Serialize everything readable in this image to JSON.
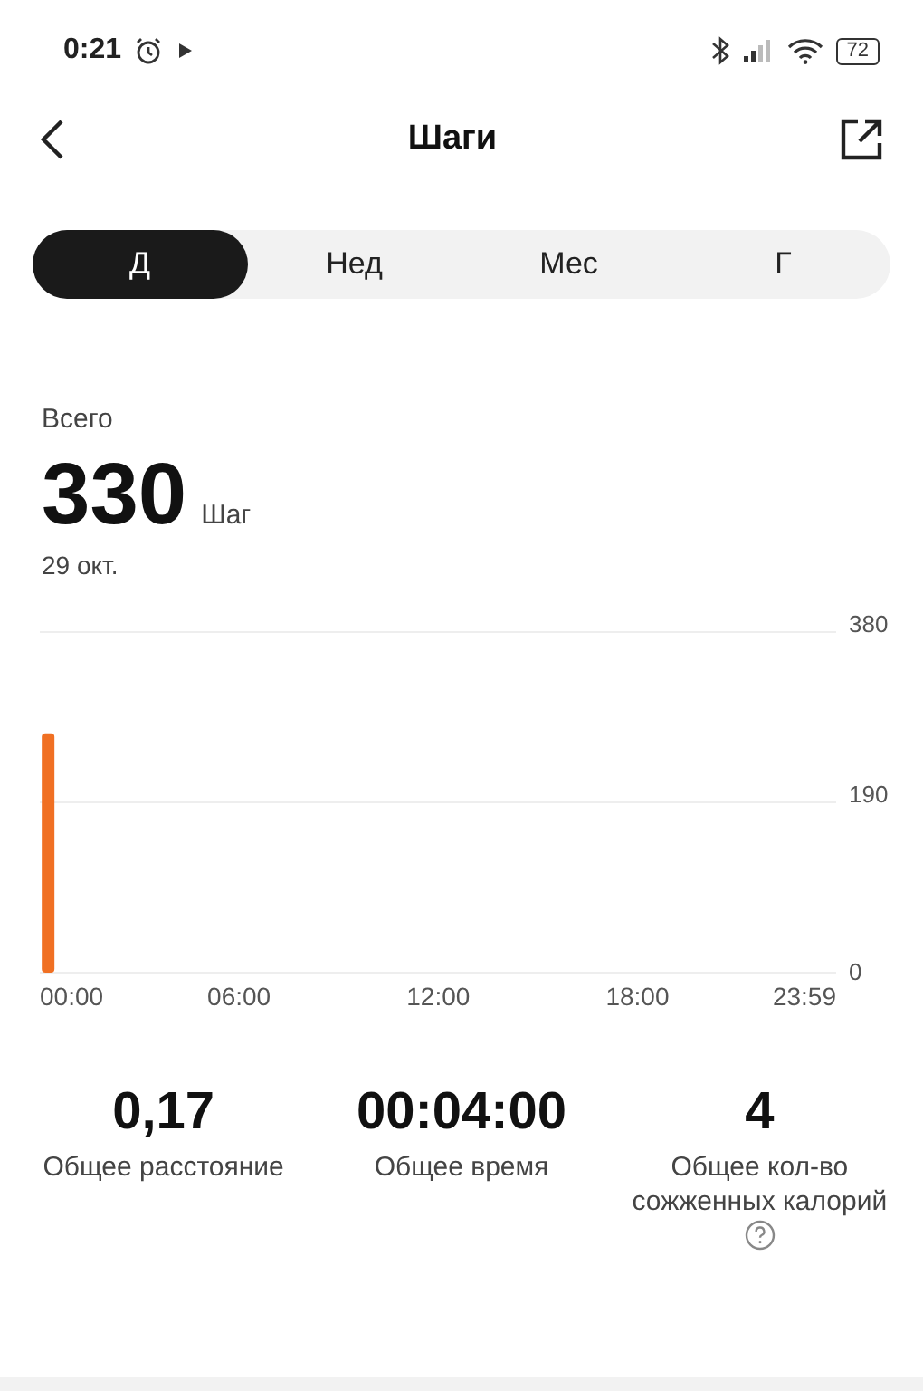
{
  "status_bar": {
    "time": "0:21",
    "battery": "72"
  },
  "header": {
    "title": "Шаги"
  },
  "tabs": [
    {
      "label": "Д",
      "selected": true
    },
    {
      "label": "Нед",
      "selected": false
    },
    {
      "label": "Мес",
      "selected": false
    },
    {
      "label": "Г",
      "selected": false
    }
  ],
  "summary": {
    "label": "Всего",
    "value": "330",
    "unit": "Шаг",
    "date": "29 окт."
  },
  "chart_data": {
    "type": "bar",
    "x": [
      15
    ],
    "values": [
      267
    ],
    "xlim": [
      0,
      1439
    ],
    "ylim": [
      0,
      380
    ],
    "xticks": [
      {
        "value": 0,
        "label": "00:00"
      },
      {
        "value": 360,
        "label": "06:00"
      },
      {
        "value": 720,
        "label": "12:00"
      },
      {
        "value": 1080,
        "label": "18:00"
      },
      {
        "value": 1439,
        "label": "23:59"
      }
    ],
    "yticks": [
      0,
      190,
      380
    ]
  },
  "stats": [
    {
      "value": "0,17",
      "label": "Общее расстояние",
      "help": false
    },
    {
      "value": "00:04:00",
      "label": "Общее время",
      "help": false
    },
    {
      "value": "4",
      "label": "Общее кол-во сожженных калорий",
      "help": true
    }
  ]
}
